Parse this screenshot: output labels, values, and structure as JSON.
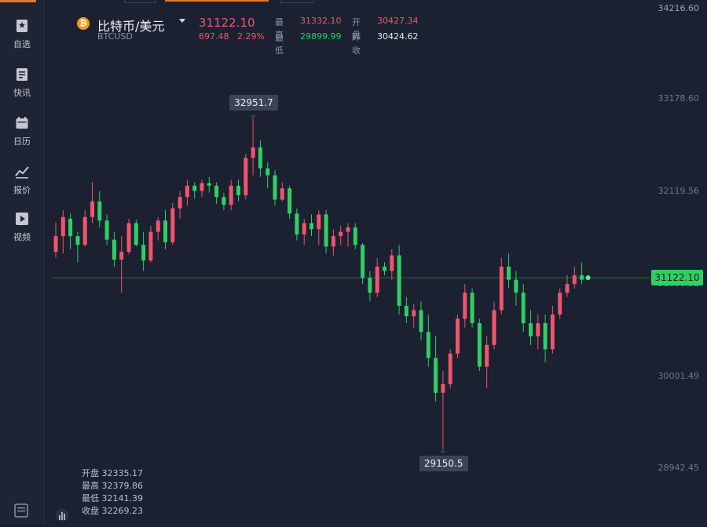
{
  "sidebar": {
    "items": [
      {
        "label": "自选",
        "icon": "bookmark-icon"
      },
      {
        "label": "快讯",
        "icon": "news-icon"
      },
      {
        "label": "日历",
        "icon": "calendar-icon"
      },
      {
        "label": "报价",
        "icon": "chart-line-icon"
      },
      {
        "label": "视频",
        "icon": "play-icon"
      }
    ]
  },
  "header": {
    "pair_name": "比特币/美元",
    "pair_code": "BTCUSD",
    "coin_symbol": "₿",
    "price": "31122.10",
    "change_abs": "697.48",
    "change_pct": "2.29%",
    "high_label": "最高",
    "high_value": "31332.10",
    "low_label": "最低",
    "low_value": "29899.99",
    "open_label": "开盘",
    "open_value": "30427.34",
    "prev_close_label": "昨收",
    "prev_close_value": "30424.62",
    "top_right_value": "34216.60"
  },
  "ohlc_panel": {
    "open": "开盘 32335.17",
    "high": "最高 32379.86",
    "low": "最低 32141.39",
    "close": "收盘 32269.23"
  },
  "colors": {
    "up": "#f0556b",
    "down": "#2fcf63",
    "accent": "#e07a2b",
    "background": "#1b2131"
  },
  "chart_data": {
    "type": "candlestick",
    "y_ticks": [
      "33178.60",
      "32119.56",
      "31060.52",
      "30001.49",
      "28942.45"
    ],
    "y_range": [
      28942.45,
      33178.6
    ],
    "current_price": "31122.10",
    "max_label": "32951.7",
    "min_label": "29150.5",
    "candles": [
      [
        31420,
        31760,
        31350,
        31600
      ],
      [
        31600,
        31900,
        31400,
        31820
      ],
      [
        31800,
        31860,
        31450,
        31600
      ],
      [
        31600,
        31650,
        31300,
        31500
      ],
      [
        31500,
        31900,
        31480,
        31820
      ],
      [
        31820,
        32220,
        31750,
        32000
      ],
      [
        32000,
        32120,
        31700,
        31780
      ],
      [
        31780,
        31850,
        31500,
        31560
      ],
      [
        31560,
        31650,
        31250,
        31330
      ],
      [
        31330,
        31600,
        30950,
        31420
      ],
      [
        31420,
        31800,
        31390,
        31750
      ],
      [
        31750,
        31790,
        31480,
        31500
      ],
      [
        31500,
        31650,
        31200,
        31320
      ],
      [
        31320,
        31720,
        31300,
        31650
      ],
      [
        31650,
        31820,
        31550,
        31780
      ],
      [
        31780,
        31900,
        31450,
        31530
      ],
      [
        31530,
        31980,
        31500,
        31920
      ],
      [
        31920,
        32120,
        31800,
        32050
      ],
      [
        32050,
        32250,
        31950,
        32180
      ],
      [
        32180,
        32220,
        32030,
        32120
      ],
      [
        32120,
        32250,
        32050,
        32210
      ],
      [
        32210,
        32280,
        32100,
        32180
      ],
      [
        32180,
        32220,
        31970,
        32050
      ],
      [
        32050,
        32100,
        31900,
        31960
      ],
      [
        31960,
        32250,
        31900,
        32180
      ],
      [
        32180,
        32250,
        32000,
        32070
      ],
      [
        32070,
        32550,
        32020,
        32500
      ],
      [
        32500,
        32951,
        32300,
        32620
      ],
      [
        32620,
        32700,
        32280,
        32380
      ],
      [
        32380,
        32450,
        32150,
        32300
      ],
      [
        32300,
        32360,
        31950,
        32020
      ],
      [
        32020,
        32220,
        32000,
        32150
      ],
      [
        32150,
        32180,
        31800,
        31860
      ],
      [
        31860,
        31920,
        31550,
        31620
      ],
      [
        31620,
        31800,
        31500,
        31750
      ],
      [
        31750,
        31850,
        31600,
        31680
      ],
      [
        31680,
        31900,
        31500,
        31850
      ],
      [
        31850,
        31900,
        31400,
        31480
      ],
      [
        31480,
        31680,
        31380,
        31600
      ],
      [
        31600,
        31720,
        31500,
        31650
      ],
      [
        31650,
        31750,
        31480,
        31700
      ],
      [
        31700,
        31750,
        31450,
        31500
      ],
      [
        31500,
        31520,
        31050,
        31120
      ],
      [
        31120,
        31200,
        30850,
        30950
      ],
      [
        30950,
        31350,
        30900,
        31250
      ],
      [
        31250,
        31300,
        31150,
        31200
      ],
      [
        31200,
        31450,
        31100,
        31380
      ],
      [
        31380,
        31500,
        30700,
        30800
      ],
      [
        30800,
        30900,
        30600,
        30680
      ],
      [
        30680,
        30820,
        30550,
        30750
      ],
      [
        30750,
        30850,
        30400,
        30500
      ],
      [
        30500,
        30700,
        30100,
        30200
      ],
      [
        30200,
        30450,
        29700,
        29800
      ],
      [
        29800,
        30050,
        29150,
        29900
      ],
      [
        29900,
        30300,
        29850,
        30250
      ],
      [
        30250,
        30700,
        30200,
        30650
      ],
      [
        30650,
        31050,
        30550,
        30950
      ],
      [
        30950,
        31000,
        30550,
        30600
      ],
      [
        30600,
        30650,
        30050,
        30100
      ],
      [
        30100,
        30450,
        29850,
        30350
      ],
      [
        30350,
        30850,
        30300,
        30750
      ],
      [
        30750,
        31350,
        30700,
        31250
      ],
      [
        31250,
        31400,
        31000,
        31100
      ],
      [
        31100,
        31200,
        30800,
        30950
      ],
      [
        30950,
        31050,
        30500,
        30600
      ],
      [
        30600,
        30750,
        30350,
        30450
      ],
      [
        30450,
        30700,
        30300,
        30600
      ],
      [
        30600,
        30700,
        30150,
        30300
      ],
      [
        30300,
        30800,
        30250,
        30700
      ],
      [
        30700,
        31000,
        30650,
        30950
      ],
      [
        30950,
        31150,
        30900,
        31050
      ],
      [
        31050,
        31250,
        31000,
        31150
      ],
      [
        31150,
        31300,
        31050,
        31100
      ]
    ]
  }
}
